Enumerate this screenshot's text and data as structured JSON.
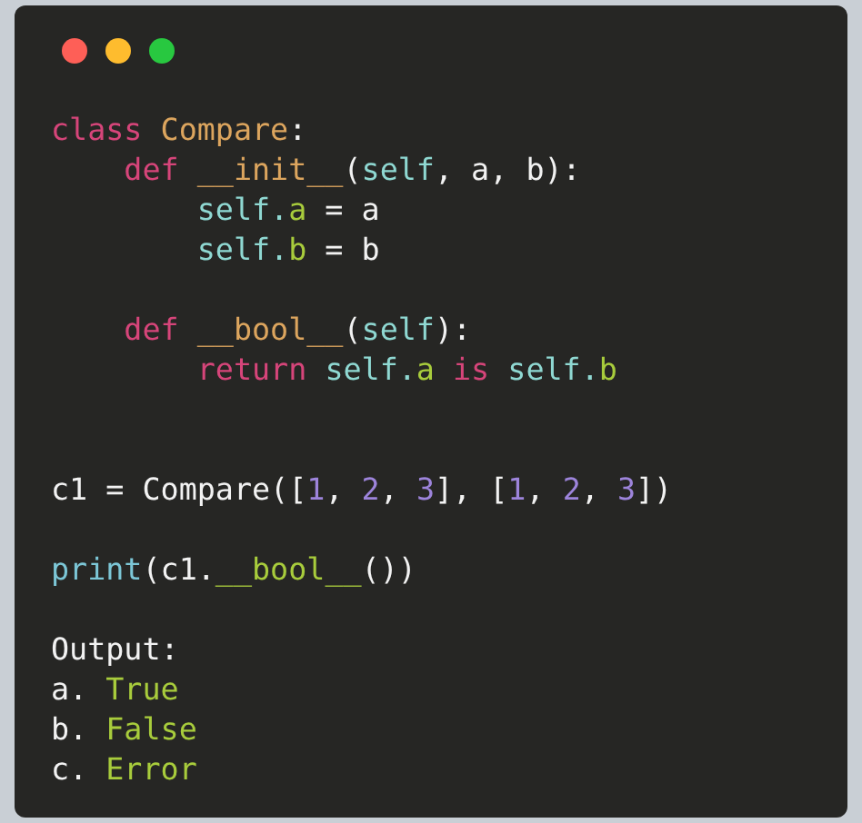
{
  "window": {
    "controls": [
      {
        "color": "#fe5f57"
      },
      {
        "color": "#febc2e"
      },
      {
        "color": "#28c840"
      }
    ]
  },
  "code": [
    {
      "kind": "code",
      "tokens": [
        {
          "text": "class ",
          "kind": "keyword"
        },
        {
          "text": "Compare",
          "kind": "name"
        },
        {
          "text": ":",
          "kind": "plain"
        }
      ],
      "children": [
        {
          "kind": "code",
          "tokens": [
            {
              "text": "def ",
              "kind": "keyword"
            },
            {
              "text": "__init__",
              "kind": "name"
            },
            {
              "text": "(",
              "kind": "plain"
            },
            {
              "text": "self",
              "kind": "self"
            },
            {
              "text": ", a, b):",
              "kind": "plain"
            }
          ],
          "children": [
            {
              "kind": "code",
              "tokens": [
                {
                  "text": "self.",
                  "kind": "self"
                },
                {
                  "text": "a",
                  "kind": "attr"
                },
                {
                  "text": " = a",
                  "kind": "plain"
                }
              ]
            },
            {
              "kind": "code",
              "tokens": [
                {
                  "text": "self.",
                  "kind": "self"
                },
                {
                  "text": "b",
                  "kind": "attr"
                },
                {
                  "text": " = b",
                  "kind": "plain"
                }
              ]
            }
          ]
        },
        {
          "kind": "blank"
        },
        {
          "kind": "code",
          "tokens": [
            {
              "text": "def ",
              "kind": "keyword"
            },
            {
              "text": "__bool__",
              "kind": "name"
            },
            {
              "text": "(",
              "kind": "plain"
            },
            {
              "text": "self",
              "kind": "self"
            },
            {
              "text": "):",
              "kind": "plain"
            }
          ],
          "children": [
            {
              "kind": "code",
              "tokens": [
                {
                  "text": "return ",
                  "kind": "keyword"
                },
                {
                  "text": "self.",
                  "kind": "self"
                },
                {
                  "text": "a",
                  "kind": "attr"
                },
                {
                  "text": " is ",
                  "kind": "keyword"
                },
                {
                  "text": "self.",
                  "kind": "self"
                },
                {
                  "text": "b",
                  "kind": "attr"
                }
              ]
            }
          ]
        }
      ]
    },
    {
      "kind": "blank"
    },
    {
      "kind": "blank"
    },
    {
      "kind": "code",
      "tokens": [
        {
          "text": "c1 = Compare([",
          "kind": "plain"
        },
        {
          "text": "1",
          "kind": "number"
        },
        {
          "text": ", ",
          "kind": "plain"
        },
        {
          "text": "2",
          "kind": "number"
        },
        {
          "text": ", ",
          "kind": "plain"
        },
        {
          "text": "3",
          "kind": "number"
        },
        {
          "text": "], [",
          "kind": "plain"
        },
        {
          "text": "1",
          "kind": "number"
        },
        {
          "text": ", ",
          "kind": "plain"
        },
        {
          "text": "2",
          "kind": "number"
        },
        {
          "text": ", ",
          "kind": "plain"
        },
        {
          "text": "3",
          "kind": "number"
        },
        {
          "text": "])",
          "kind": "plain"
        }
      ]
    },
    {
      "kind": "blank"
    },
    {
      "kind": "code",
      "tokens": [
        {
          "text": "print",
          "kind": "builtin"
        },
        {
          "text": "(c1.",
          "kind": "plain"
        },
        {
          "text": "__bool__",
          "kind": "attr"
        },
        {
          "text": "())",
          "kind": "plain"
        }
      ]
    },
    {
      "kind": "blank"
    },
    {
      "kind": "code",
      "tokens": [
        {
          "text": "Output:",
          "kind": "plain"
        }
      ]
    },
    {
      "kind": "code",
      "tokens": [
        {
          "text": "a. ",
          "kind": "plain"
        },
        {
          "text": "True",
          "kind": "attr"
        }
      ]
    },
    {
      "kind": "code",
      "tokens": [
        {
          "text": "b. ",
          "kind": "plain"
        },
        {
          "text": "False",
          "kind": "attr"
        }
      ]
    },
    {
      "kind": "code",
      "tokens": [
        {
          "text": "c. ",
          "kind": "plain"
        },
        {
          "text": "Error",
          "kind": "attr"
        }
      ]
    }
  ]
}
